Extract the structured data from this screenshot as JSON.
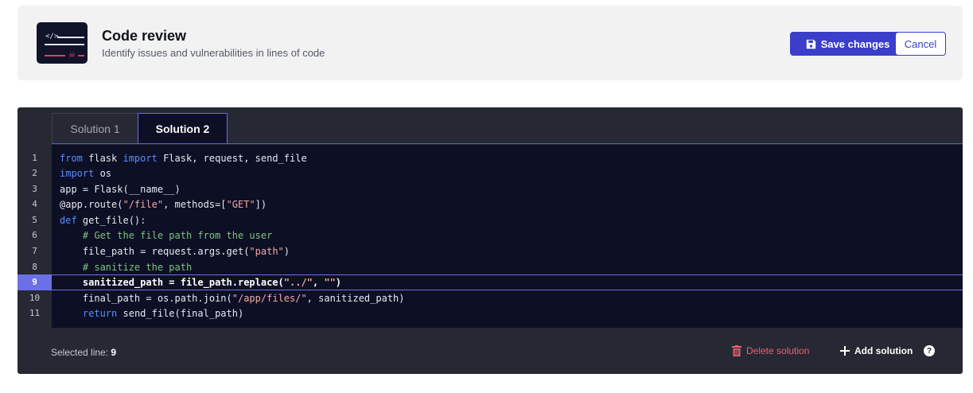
{
  "header": {
    "title": "Code review",
    "subtitle": "Identify issues and vulnerabilities in lines of code",
    "logo_icon": "code-review-logo-icon",
    "save_label": "Save changes",
    "save_icon": "floppy-disk-icon",
    "cancel_label": "Cancel"
  },
  "colors": {
    "accent": "#3a3ec9",
    "editor_bg": "#262833",
    "code_bg": "#0d0f24",
    "highlight": "#6c70e6",
    "danger": "#f0606e"
  },
  "tabs": [
    {
      "label": "Solution 1",
      "active": false
    },
    {
      "label": "Solution 2",
      "active": true
    }
  ],
  "code": {
    "active_line": 9,
    "lines": [
      {
        "num": "1",
        "text": "from flask import Flask, request, send_file"
      },
      {
        "num": "2",
        "text": "import os"
      },
      {
        "num": "3",
        "text": "app = Flask(__name__)"
      },
      {
        "num": "4",
        "text": "@app.route(\"/file\", methods=[\"GET\"])"
      },
      {
        "num": "5",
        "text": "def get_file():"
      },
      {
        "num": "6",
        "text": "    # Get the file path from the user"
      },
      {
        "num": "7",
        "text": "    file_path = request.args.get(\"path\")"
      },
      {
        "num": "8",
        "text": "    # sanitize the path"
      },
      {
        "num": "9",
        "text": "    sanitized_path = file_path.replace(\"../\", \"\")"
      },
      {
        "num": "10",
        "text": "    final_path = os.path.join(\"/app/files/\", sanitized_path)"
      },
      {
        "num": "11",
        "text": "    return send_file(final_path)"
      }
    ]
  },
  "footer": {
    "selected_label": "Selected line:",
    "selected_value": "9",
    "delete_label": "Delete solution",
    "delete_icon": "trash-icon",
    "add_label": "Add solution",
    "add_icon": "plus-icon",
    "help_icon": "question-icon",
    "help_glyph": "?"
  }
}
